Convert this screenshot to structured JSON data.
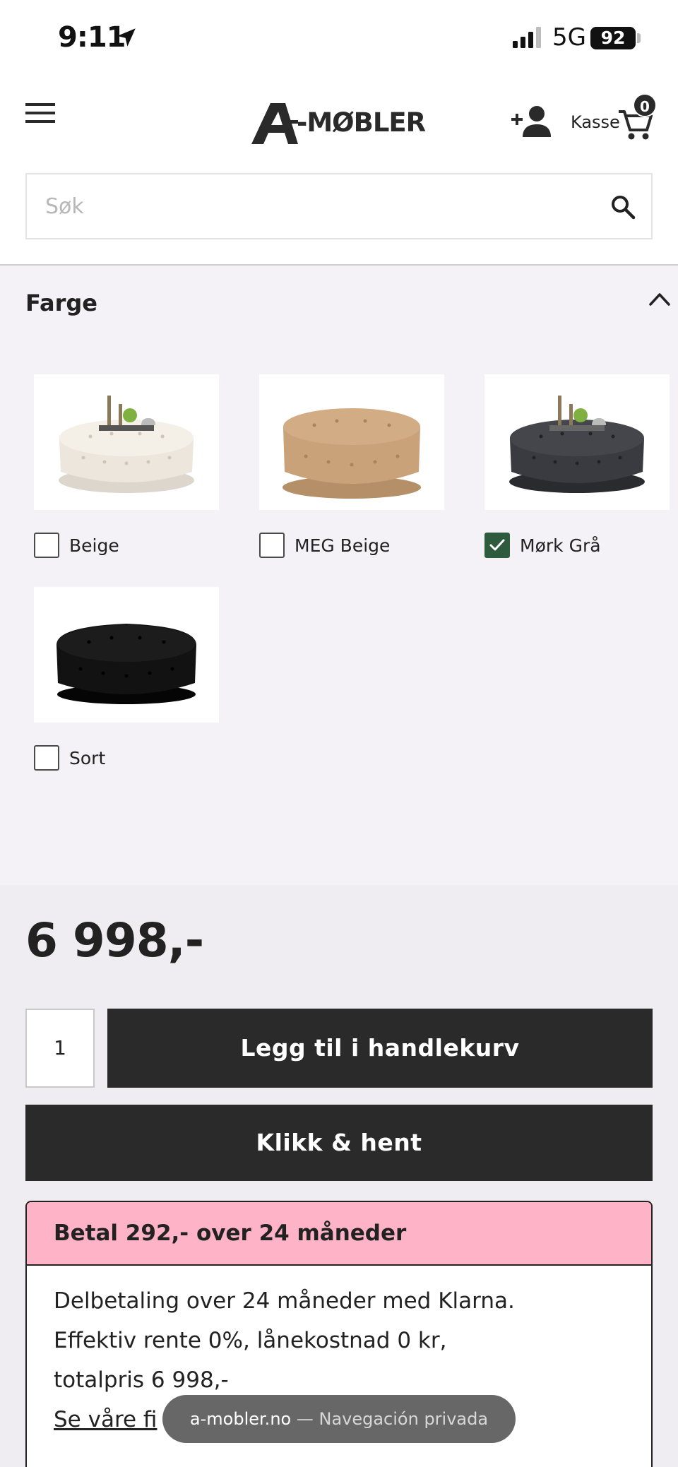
{
  "status_bar": {
    "time": "9:11",
    "network": "5G",
    "battery": "92"
  },
  "header": {
    "logo_text": "-MØBLER",
    "checkout_label": "Kasse",
    "cart_count": "0"
  },
  "search": {
    "placeholder": "Søk",
    "value": ""
  },
  "filter": {
    "title": "Farge",
    "options": [
      {
        "label": "Beige",
        "checked": false,
        "color": "#ece6dc"
      },
      {
        "label": "MEG Beige",
        "checked": false,
        "color": "#c9a27a"
      },
      {
        "label": "Mørk Grå",
        "checked": true,
        "color": "#3a3b40"
      },
      {
        "label": "Sort",
        "checked": false,
        "color": "#121212"
      }
    ]
  },
  "product": {
    "price": "6 998,-",
    "quantity": "1",
    "add_to_cart_label": "Legg til i handlekurv",
    "click_collect_label": "Klikk & hent"
  },
  "klarna": {
    "title": "Betal 292,- over 24 måneder",
    "line1": "Delbetaling over 24 måneder med Klarna.",
    "line2": "Effektiv rente 0%, lånekostnad 0 kr,",
    "line3": "totalpris 6 998,-",
    "link_text": "Se våre fi"
  },
  "browser": {
    "domain": "a-mobler.no",
    "mode": "— Navegación privada"
  },
  "colors": {
    "accent_dark": "#2a2a2a",
    "klarna_pink": "#ffb3c7",
    "check_green": "#2e5b3e"
  }
}
